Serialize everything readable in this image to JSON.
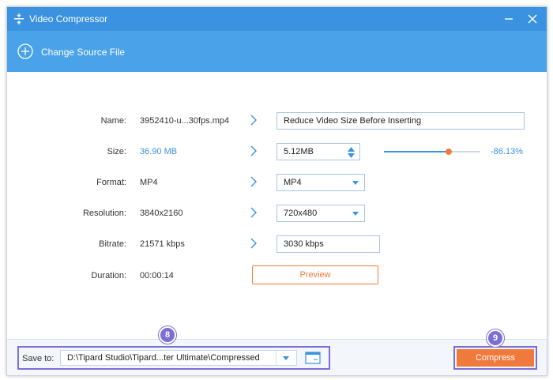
{
  "window": {
    "title": "Video Compressor"
  },
  "toolbar": {
    "change_source_label": "Change Source File"
  },
  "form": {
    "name": {
      "label": "Name:",
      "source": "3952410-u...30fps.mp4",
      "output": "Reduce Video Size Before Inserting"
    },
    "size": {
      "label": "Size:",
      "source": "36.90 MB",
      "output": "5.12MB",
      "slider_level": 0.67,
      "percent": "-86.13%"
    },
    "format": {
      "label": "Format:",
      "source": "MP4",
      "output": "MP4"
    },
    "resolution": {
      "label": "Resolution:",
      "source": "3840x2160",
      "output": "720x480"
    },
    "bitrate": {
      "label": "Bitrate:",
      "source": "21571 kbps",
      "output": "3030 kbps"
    },
    "duration": {
      "label": "Duration:",
      "source": "00:00:14"
    },
    "preview_label": "Preview"
  },
  "bottom": {
    "save_to_label": "Save to:",
    "save_path": "D:\\Tipard Studio\\Tipard...ter Ultimate\\Compressed",
    "compress_label": "Compress",
    "badge_save": "8",
    "badge_compress": "9"
  },
  "colors": {
    "titlebar": "#3a92e0",
    "toolbar": "#4aa3e9",
    "accent_orange": "#f07a3c",
    "highlight_purple": "#7b6fd6"
  }
}
